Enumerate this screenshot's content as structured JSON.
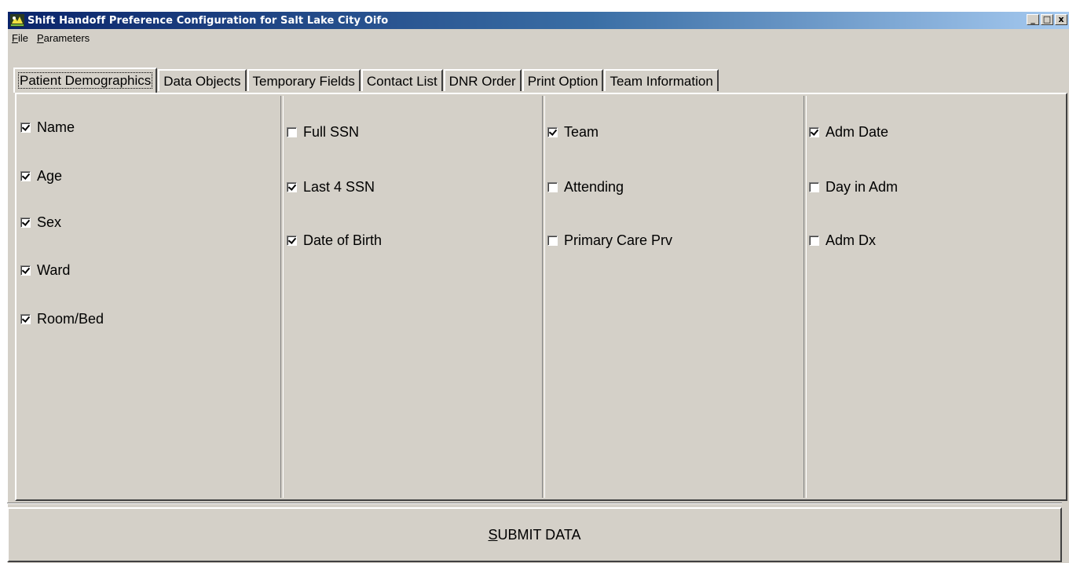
{
  "window": {
    "title": "Shift Handoff Preference Configuration for Salt Lake City Oifo",
    "minimize_glyph": "_",
    "maximize_glyph": "□",
    "close_glyph": "x"
  },
  "menu": [
    {
      "underline": "F",
      "rest": "ile"
    },
    {
      "underline": "P",
      "rest": "arameters"
    }
  ],
  "tabs": [
    {
      "label": "Patient Demographics",
      "active": true
    },
    {
      "label": "Data Objects",
      "active": false
    },
    {
      "label": "Temporary Fields",
      "active": false
    },
    {
      "label": "Contact List",
      "active": false
    },
    {
      "label": "DNR Order",
      "active": false
    },
    {
      "label": "Print Option",
      "active": false
    },
    {
      "label": "Team Information",
      "active": false
    }
  ],
  "columns": [
    {
      "items": [
        {
          "label": "Name",
          "checked": true
        },
        {
          "label": "Age",
          "checked": true
        },
        {
          "label": "Sex",
          "checked": true
        },
        {
          "label": "Ward",
          "checked": true
        },
        {
          "label": "Room/Bed",
          "checked": true
        }
      ]
    },
    {
      "items": [
        {
          "label": "Full SSN",
          "checked": false
        },
        {
          "label": "Last 4 SSN",
          "checked": true
        },
        {
          "label": "Date of Birth",
          "checked": true
        }
      ]
    },
    {
      "items": [
        {
          "label": "Team",
          "checked": true
        },
        {
          "label": "Attending",
          "checked": false
        },
        {
          "label": "Primary Care Prv",
          "checked": false
        }
      ]
    },
    {
      "items": [
        {
          "label": "Adm Date",
          "checked": true
        },
        {
          "label": "Day in Adm",
          "checked": false
        },
        {
          "label": "Adm Dx",
          "checked": false
        }
      ]
    }
  ],
  "submit": {
    "underline": "S",
    "rest": "UBMIT DATA"
  }
}
